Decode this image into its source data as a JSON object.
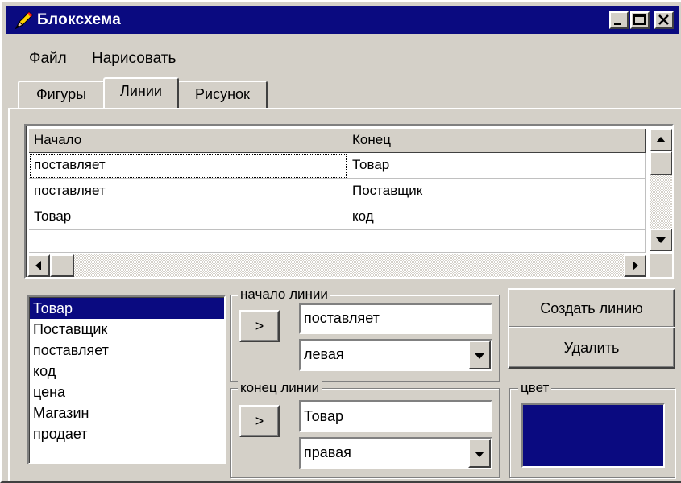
{
  "window": {
    "title": "Блоксхема",
    "icon": "pencil-icon",
    "controls": [
      "minimize",
      "maximize",
      "close"
    ]
  },
  "menu": {
    "items": [
      {
        "label": "Файл",
        "accel": "Ф",
        "rest": "айл"
      },
      {
        "label": "Нарисовать",
        "accel": "Н",
        "rest": "арисовать"
      }
    ]
  },
  "tabs": [
    {
      "label": "Фигуры",
      "active": false
    },
    {
      "label": "Линии",
      "active": true
    },
    {
      "label": "Рисунок",
      "active": false
    }
  ],
  "grid": {
    "columns": [
      "Начало",
      "Конец"
    ],
    "rows": [
      [
        "поставляет",
        "Товар"
      ],
      [
        "поставляет",
        "Поставщик"
      ],
      [
        "Товар",
        "код"
      ]
    ],
    "focused_row": 0
  },
  "list": {
    "items": [
      "Товар",
      "Поставщик",
      "поставляет",
      "код",
      "цена",
      "Магазин",
      "продает"
    ],
    "selected_index": 0
  },
  "line_start": {
    "legend": "начало линии",
    "pick_label": ">",
    "value": "поставляет",
    "side": "левая"
  },
  "line_end": {
    "legend": "конец линии",
    "pick_label": ">",
    "value": "Товар",
    "side": "правая"
  },
  "actions": {
    "create_label": "Создать линию",
    "delete_label": "Удалить"
  },
  "color": {
    "legend": "цвет",
    "value": "#0a0a80"
  },
  "colors": {
    "face": "#d4d0c8",
    "titlebar": "#0a0a80",
    "selection": "#0a0a80"
  }
}
